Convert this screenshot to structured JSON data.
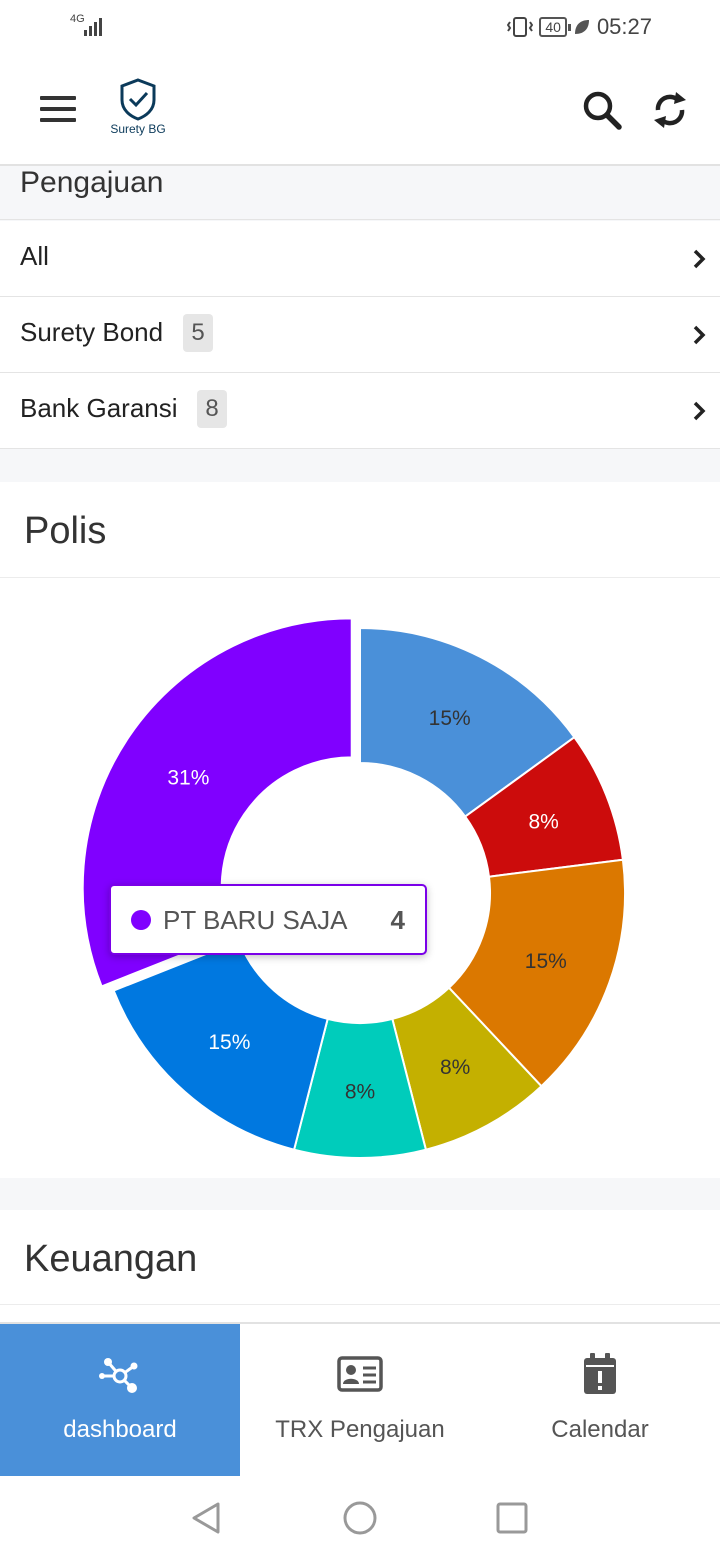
{
  "status_bar": {
    "network": "4G",
    "battery": "40",
    "time": "05:27"
  },
  "app": {
    "logo_text": "Surety BG"
  },
  "pengajuan": {
    "title": "Pengajuan",
    "rows": [
      {
        "label": "All",
        "badge": null
      },
      {
        "label": "Surety Bond",
        "badge": "5"
      },
      {
        "label": "Bank Garansi",
        "badge": "8"
      }
    ]
  },
  "polis": {
    "title": "Polis",
    "tooltip": {
      "label": "PT BARU SAJA",
      "value": "4",
      "color": "#8000ff"
    }
  },
  "chart_data": {
    "type": "pie",
    "donut": true,
    "title": "",
    "slices": [
      {
        "percent": 15,
        "label": "15%",
        "color": "#4a90d9"
      },
      {
        "percent": 8,
        "label": "8%",
        "color": "#cc0c0c"
      },
      {
        "percent": 15,
        "label": "15%",
        "color": "#db7800"
      },
      {
        "percent": 8,
        "label": "8%",
        "color": "#c4b000"
      },
      {
        "percent": 8,
        "label": "8%",
        "color": "#00ccbb"
      },
      {
        "percent": 15,
        "label": "15%",
        "color": "#0078e0"
      },
      {
        "percent": 31,
        "label": "31%",
        "color": "#8000ff"
      }
    ],
    "highlighted_slice": 6
  },
  "keuangan": {
    "title": "Keuangan"
  },
  "bottom_nav": [
    {
      "label": "dashboard",
      "icon": "dashboard-icon",
      "active": true
    },
    {
      "label": "TRX Pengajuan",
      "icon": "id-card-icon",
      "active": false
    },
    {
      "label": "Calendar",
      "icon": "calendar-alert-icon",
      "active": false
    }
  ]
}
